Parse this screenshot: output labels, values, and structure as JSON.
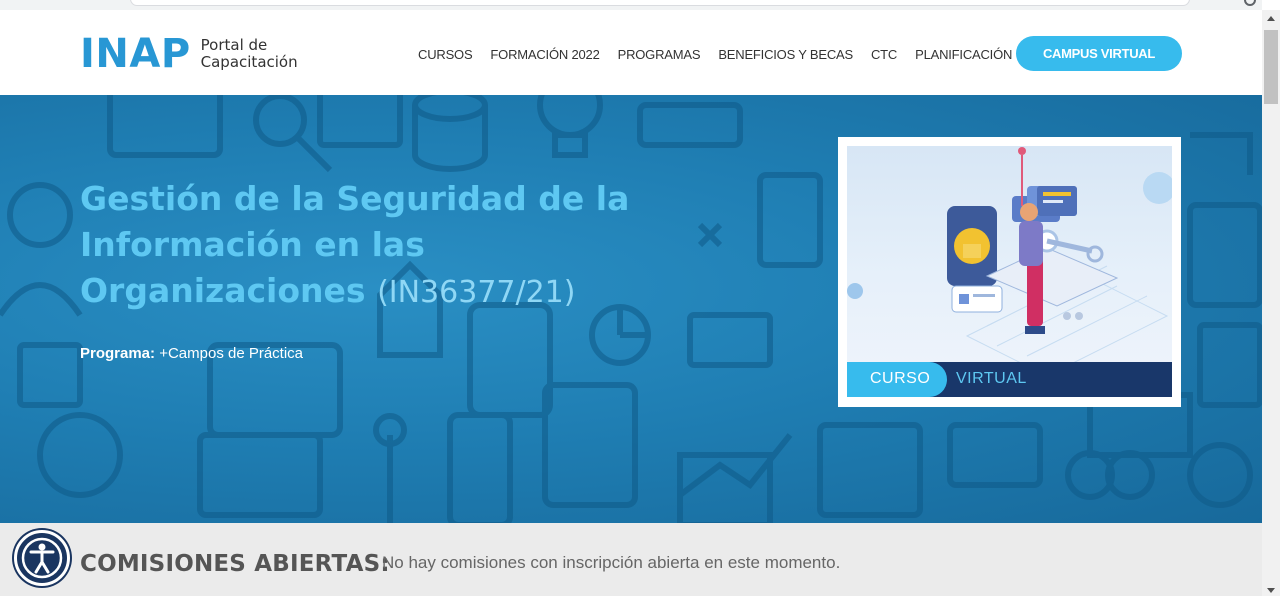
{
  "header": {
    "logo_mark": "INAP",
    "logo_sub_line1": "Portal de",
    "logo_sub_line2": "Capacitación",
    "nav": [
      "CURSOS",
      "FORMACIÓN 2022",
      "PROGRAMAS",
      "BENEFICIOS Y BECAS",
      "CTC",
      "PLANIFICACIÓN"
    ],
    "cta_label": "CAMPUS VIRTUAL"
  },
  "hero": {
    "title_line1": "Gestión de la Seguridad de la",
    "title_line2": "Información en las",
    "title_line3": "Organizaciones",
    "course_code": "(IN36377/21)",
    "program_label": "Programa:",
    "program_value": "+Campos de Práctica"
  },
  "card": {
    "label_type": "CURSO",
    "label_mode": "VIRTUAL"
  },
  "commissions": {
    "title": "COMISIONES ABIERTAS:",
    "message": "No hay comisiones con inscripción abierta en este momento."
  },
  "colors": {
    "brand_blue": "#2897d4",
    "accent_cyan": "#37bbed",
    "hero_blue": "#1f7eb3",
    "title_cyan": "#5ec8f2",
    "navy": "#19376a"
  },
  "icons": [
    "accessibility-icon",
    "scroll-up-icon",
    "scroll-down-icon"
  ]
}
